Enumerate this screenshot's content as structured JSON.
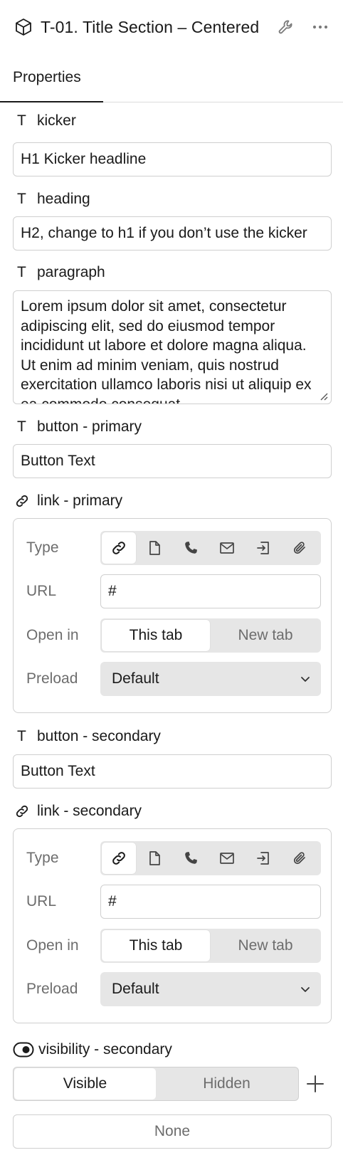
{
  "header": {
    "title": "T-01. Title Section – Centered",
    "component_icon": "cube-icon",
    "settings_icon": "wrench-icon",
    "more_icon": "more-horizontal-icon"
  },
  "tabs": [
    {
      "label": "Properties",
      "active": true
    }
  ],
  "fields": {
    "kicker": {
      "label": "kicker",
      "type_glyph": "T",
      "value": "H1 Kicker headline"
    },
    "heading": {
      "label": "heading",
      "type_glyph": "T",
      "value": "H2, change to h1 if you don’t use the kicker"
    },
    "paragraph": {
      "label": "paragraph",
      "type_glyph": "T",
      "value": "Lorem ipsum dolor sit amet, consectetur adipiscing elit, sed do eiusmod tempor incididunt ut labore et dolore magna aliqua. Ut enim ad minim veniam, quis nostrud exercitation ullamco laboris nisi ut aliquip ex ea commodo consequat."
    },
    "button_primary": {
      "label": "button - primary",
      "type_glyph": "T",
      "value": "Button Text"
    },
    "button_secondary": {
      "label": "button - secondary",
      "type_glyph": "T",
      "value": "Button Text"
    }
  },
  "link_primary": {
    "label": "link - primary",
    "type_label": "Type",
    "type_options": [
      "link-icon",
      "page-icon",
      "phone-icon",
      "email-icon",
      "section-icon",
      "attachment-icon"
    ],
    "type_selected": "link-icon",
    "url_label": "URL",
    "url_value": "#",
    "open_in_label": "Open in",
    "open_in_options": [
      "This tab",
      "New tab"
    ],
    "open_in_selected": "This tab",
    "preload_label": "Preload",
    "preload_value": "Default"
  },
  "link_secondary": {
    "label": "link - secondary",
    "type_label": "Type",
    "type_options": [
      "link-icon",
      "page-icon",
      "phone-icon",
      "email-icon",
      "section-icon",
      "attachment-icon"
    ],
    "type_selected": "link-icon",
    "url_label": "URL",
    "url_value": "#",
    "open_in_label": "Open in",
    "open_in_options": [
      "This tab",
      "New tab"
    ],
    "open_in_selected": "This tab",
    "preload_label": "Preload",
    "preload_value": "Default"
  },
  "visibility_secondary": {
    "label": "visibility - secondary",
    "options": [
      "Visible",
      "Hidden"
    ],
    "selected": "Visible",
    "condition_value": "None"
  },
  "colors": {
    "text": "#1a1a1a",
    "muted": "#6d6d6d",
    "border": "#cfcfcf",
    "segment_bg": "#e6e6e6"
  }
}
